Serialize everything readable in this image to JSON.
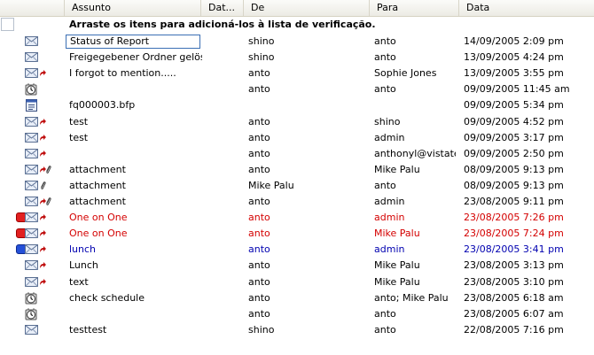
{
  "columns": {
    "assunto": "Assunto",
    "dat": "Dat...",
    "de": "De",
    "para": "Para",
    "data": "Data"
  },
  "drag_text": "Arraste os itens para adicioná-los à lista de verificação.",
  "rows": [
    {
      "icon": "envelope-icon",
      "reply": false,
      "attach": false,
      "flag": "",
      "color": "",
      "subject": "Status of Report",
      "from": "shino",
      "to": "anto",
      "date": "14/09/2005 2:09 pm",
      "selected": true
    },
    {
      "icon": "envelope-icon",
      "reply": false,
      "attach": false,
      "flag": "",
      "color": "",
      "subject": "Freigegebener Ordner gelösc",
      "from": "shino",
      "to": "anto",
      "date": "13/09/2005 4:24 pm"
    },
    {
      "icon": "envelope-icon",
      "reply": true,
      "attach": false,
      "flag": "",
      "color": "",
      "subject": "I forgot to mention.....",
      "from": "anto",
      "to": "Sophie Jones",
      "date": "13/09/2005 3:55 pm"
    },
    {
      "icon": "clock-icon",
      "reply": false,
      "attach": false,
      "flag": "",
      "color": "",
      "subject": "",
      "from": "anto",
      "to": "anto",
      "date": "09/09/2005 11:45 am"
    },
    {
      "icon": "document-icon",
      "reply": false,
      "attach": false,
      "flag": "",
      "color": "",
      "subject": "fq000003.bfp",
      "from": "",
      "to": "",
      "date": "09/09/2005 5:34 pm"
    },
    {
      "icon": "envelope-icon",
      "reply": true,
      "attach": false,
      "flag": "",
      "color": "",
      "subject": "test",
      "from": "anto",
      "to": "shino",
      "date": "09/09/2005 4:52 pm"
    },
    {
      "icon": "envelope-icon",
      "reply": true,
      "attach": false,
      "flag": "",
      "color": "",
      "subject": "test",
      "from": "anto",
      "to": "admin",
      "date": "09/09/2005 3:17 pm"
    },
    {
      "icon": "envelope-icon",
      "reply": true,
      "attach": false,
      "flag": "",
      "color": "",
      "subject": "",
      "from": "anto",
      "to": "anthonyl@vistate",
      "date": "09/09/2005 2:50 pm"
    },
    {
      "icon": "envelope-icon",
      "reply": true,
      "attach": true,
      "flag": "",
      "color": "",
      "subject": "attachment",
      "from": "anto",
      "to": "Mike Palu",
      "date": "08/09/2005 9:13 pm"
    },
    {
      "icon": "envelope-icon",
      "reply": false,
      "attach": true,
      "flag": "",
      "color": "",
      "subject": "attachment",
      "from": "Mike Palu",
      "to": "anto",
      "date": "08/09/2005 9:13 pm"
    },
    {
      "icon": "envelope-icon",
      "reply": true,
      "attach": true,
      "flag": "",
      "color": "",
      "subject": "attachment",
      "from": "anto",
      "to": "admin",
      "date": "23/08/2005 9:11 pm"
    },
    {
      "icon": "envelope-icon",
      "reply": true,
      "attach": false,
      "flag": "red",
      "color": "red",
      "subject": "One on One",
      "from": "anto",
      "to": "admin",
      "date": "23/08/2005 7:26 pm"
    },
    {
      "icon": "envelope-icon",
      "reply": true,
      "attach": false,
      "flag": "red",
      "color": "red",
      "subject": "One on One",
      "from": "anto",
      "to": "Mike Palu",
      "date": "23/08/2005 7:24 pm"
    },
    {
      "icon": "envelope-icon",
      "reply": true,
      "attach": false,
      "flag": "blue",
      "color": "blue",
      "subject": "lunch",
      "from": "anto",
      "to": "admin",
      "date": "23/08/2005 3:41 pm"
    },
    {
      "icon": "envelope-icon",
      "reply": true,
      "attach": false,
      "flag": "",
      "color": "",
      "subject": "Lunch",
      "from": "anto",
      "to": "Mike Palu",
      "date": "23/08/2005 3:13 pm"
    },
    {
      "icon": "envelope-icon",
      "reply": true,
      "attach": false,
      "flag": "",
      "color": "",
      "subject": "text",
      "from": "anto",
      "to": "Mike Palu",
      "date": "23/08/2005 3:10 pm"
    },
    {
      "icon": "clock-icon",
      "reply": false,
      "attach": false,
      "flag": "",
      "color": "",
      "subject": "check schedule",
      "from": "anto",
      "to": "anto;  Mike Palu",
      "date": "23/08/2005 6:18 am"
    },
    {
      "icon": "clock-icon",
      "reply": false,
      "attach": false,
      "flag": "",
      "color": "",
      "subject": "",
      "from": "anto",
      "to": "anto",
      "date": "23/08/2005 6:07 am"
    },
    {
      "icon": "envelope-icon",
      "reply": false,
      "attach": false,
      "flag": "",
      "color": "",
      "subject": "testtest",
      "from": "shino",
      "to": "anto",
      "date": "22/08/2005 7:16 pm"
    }
  ],
  "colors": {
    "red_text": "#d40000",
    "blue_text": "#0000b0",
    "selection_border": "#3b6fb4"
  }
}
